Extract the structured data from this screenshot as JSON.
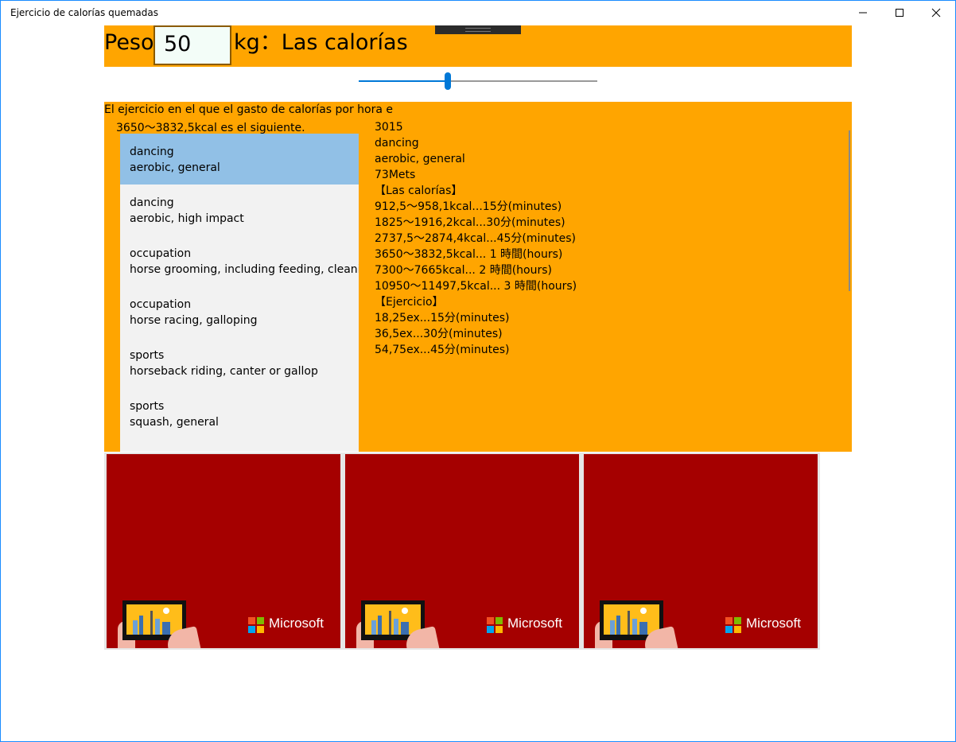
{
  "window": {
    "title": "Ejercicio de calorías quemadas",
    "min_icon": "minimize-icon",
    "max_icon": "maximize-icon",
    "close_icon": "close-icon"
  },
  "header": {
    "label_weight": "Peso",
    "weight_value": "50",
    "label_unit": "kg：Las calorías",
    "background_color": "#ffa500"
  },
  "slider": {
    "level": 0.37,
    "accent_color": "#0078d7"
  },
  "description": {
    "line1": "El ejercicio en el que el gasto de calorías por hora e",
    "line2": "3650～3832,5kcal es el siguiente."
  },
  "exercise_list": [
    {
      "category": "dancing",
      "activity": "aerobic, general",
      "selected": true
    },
    {
      "category": "dancing",
      "activity": "aerobic, high impact",
      "selected": false
    },
    {
      "category": "occupation",
      "activity": "horse grooming, including feeding, cleaning",
      "selected": false
    },
    {
      "category": "occupation",
      "activity": "horse racing, galloping",
      "selected": false
    },
    {
      "category": "sports",
      "activity": "horseback riding, canter or gallop",
      "selected": false
    },
    {
      "category": "sports",
      "activity": "squash, general",
      "selected": false
    }
  ],
  "detail": {
    "lines": [
      "3015",
      "dancing",
      "aerobic, general",
      "73Mets",
      "【Las calorías】",
      "912,5～958,1kcal...15分(minutes)",
      "1825～1916,2kcal...30分(minutes)",
      "2737,5～2874,4kcal...45分(minutes)",
      "3650～3832,5kcal... 1 時間(hours)",
      "7300～7665kcal... 2 時間(hours)",
      "10950～11497,5kcal... 3 時間(hours)",
      "【Ejercicio】",
      "18,25ex...15分(minutes)",
      "36,5ex...30分(minutes)",
      "54,75ex...45分(minutes)"
    ]
  },
  "ads": [
    {
      "brand": "Microsoft",
      "background_color": "#a50000"
    },
    {
      "brand": "Microsoft",
      "background_color": "#a50000"
    },
    {
      "brand": "Microsoft",
      "background_color": "#a50000"
    }
  ]
}
